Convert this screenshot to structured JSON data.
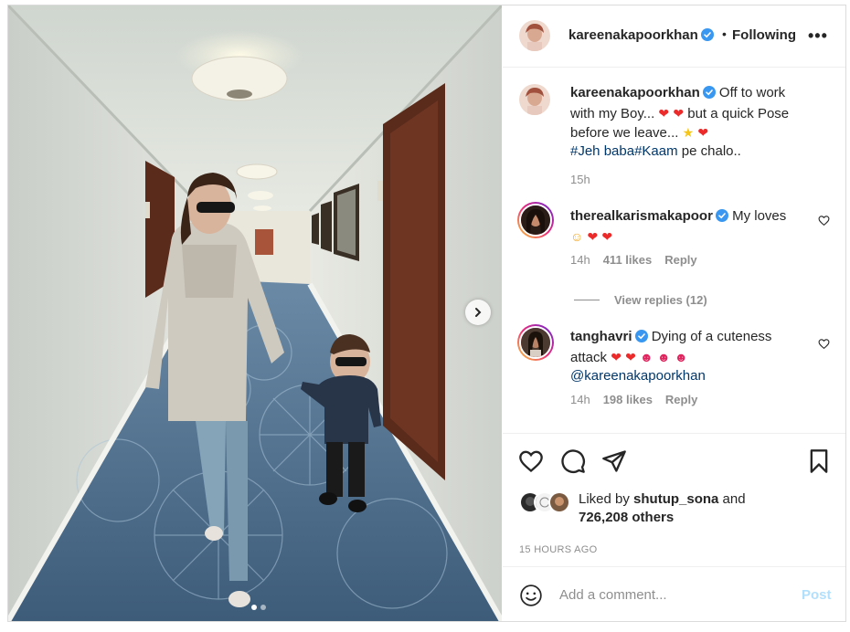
{
  "post": {
    "author": "kareenakapoorkhan",
    "header_separator": "•",
    "follow_state": "Following",
    "more_label": "•••",
    "caption": {
      "username": "kareenakapoorkhan",
      "line1": "Off to work",
      "line2a": "with my Boy...",
      "line2b": "but a quick Pose",
      "line3": "before we leave...",
      "hashtag1": "#Jeh baba",
      "hashtag2": "#Kaam",
      "line4_rest": " pe chalo..",
      "time": "15h"
    }
  },
  "comments": [
    {
      "username": "therealkarismakapoor",
      "text": "My loves",
      "time": "14h",
      "likes": "411 likes",
      "reply": "Reply",
      "view_replies": "View replies (12)"
    },
    {
      "username": "tanghavri",
      "text_line1": "Dying of a cuteness",
      "text_line2": "attack",
      "mention": "@kareenakapoorkhan",
      "time": "14h",
      "likes": "198 likes",
      "reply": "Reply"
    }
  ],
  "engagement": {
    "liked_by_prefix": "Liked by ",
    "liked_by_user": "shutup_sona",
    "liked_by_and": " and",
    "others_count": "726,208 others",
    "timestamp": "15 HOURS AGO"
  },
  "composer": {
    "placeholder": "Add a comment...",
    "post_label": "Post"
  },
  "carousel": {
    "current_index": 1,
    "total": 2
  },
  "colors": {
    "verified_blue": "#3897f0",
    "heart_red": "#ed2a2a",
    "hashtag_blue": "#00376b",
    "post_button_disabled": "#b2dffc",
    "muted_text": "#8e8e8e"
  }
}
